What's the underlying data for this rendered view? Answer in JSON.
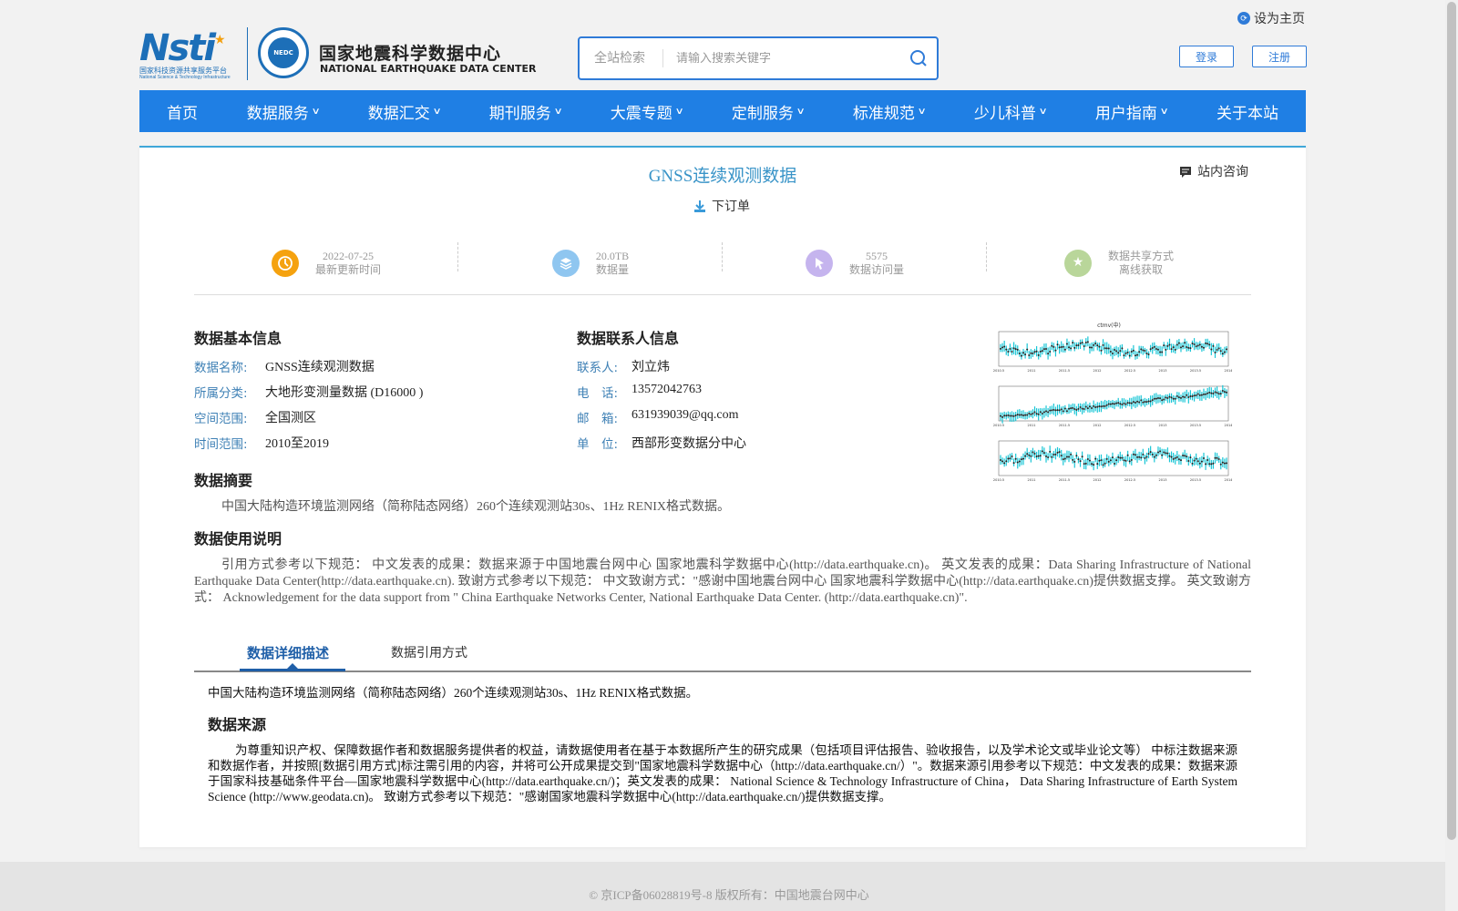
{
  "header": {
    "set_home": "设为主页",
    "logo": {
      "nsti_text": "Nsti",
      "nsti_sub": "国家科技资源共享服务平台",
      "nsti_sub_en": "National Science & Technology Infrastructure",
      "seal_text": "NEDC",
      "cn_name": "国家地震科学数据中心",
      "en_name": "NATIONAL EARTHQUAKE DATA CENTER"
    },
    "search": {
      "scope": "全站检索",
      "placeholder": "请输入搜索关键字"
    },
    "login": "登录",
    "register": "注册"
  },
  "nav": [
    {
      "label": "首页",
      "has_dropdown": false
    },
    {
      "label": "数据服务",
      "has_dropdown": true
    },
    {
      "label": "数据汇交",
      "has_dropdown": true
    },
    {
      "label": "期刊服务",
      "has_dropdown": true
    },
    {
      "label": "大震专题",
      "has_dropdown": true
    },
    {
      "label": "定制服务",
      "has_dropdown": true
    },
    {
      "label": "标准规范",
      "has_dropdown": true
    },
    {
      "label": "少儿科普",
      "has_dropdown": true
    },
    {
      "label": "用户指南",
      "has_dropdown": true
    },
    {
      "label": "关于本站",
      "has_dropdown": false
    }
  ],
  "dataset": {
    "title": "GNSS连续观测数据",
    "order": "下订单",
    "consult": "站内咨询",
    "stats": [
      {
        "value": "2022-07-25",
        "label": "最新更新时间",
        "icon": "clock-icon",
        "color": "#f5a20f"
      },
      {
        "value": "20.0TB",
        "label": "数据量",
        "icon": "layers-icon",
        "color": "#8fc6f0"
      },
      {
        "value": "5575",
        "label": "数据访问量",
        "icon": "cursor-icon",
        "color": "#c5b4ee"
      },
      {
        "value": "数据共享方式",
        "label": "离线获取",
        "icon": "star-icon",
        "color": "#b9d69a"
      }
    ],
    "basic_info": {
      "heading": "数据基本信息",
      "fields": [
        {
          "key": "数据名称:",
          "value": "GNSS连续观测数据"
        },
        {
          "key": "所属分类:",
          "value": "大地形变测量数据 (D16000 )"
        },
        {
          "key": "空间范围:",
          "value": "全国测区"
        },
        {
          "key": "时间范围:",
          "value": "2010至2019"
        }
      ]
    },
    "contact_info": {
      "heading": "数据联系人信息",
      "fields": [
        {
          "key": "联系人:",
          "value": "刘立炜"
        },
        {
          "key": "电　话:",
          "value": "13572042763"
        },
        {
          "key": "邮　箱:",
          "value": "631939039@qq.com"
        },
        {
          "key": "单　位:",
          "value": "西部形变数据分中心"
        }
      ]
    },
    "abstract": {
      "heading": "数据摘要",
      "text": "中国大陆构造环境监测网络（简称陆态网络）260个连续观测站30s、1Hz RENIX格式数据。"
    },
    "usage": {
      "heading": "数据使用说明",
      "text": "引用方式参考以下规范： 中文发表的成果：数据来源于中国地震台网中心 国家地震科学数据中心(http://data.earthquake.cn)。 英文发表的成果：Data Sharing Infrastructure of National Earthquake Data Center(http://data.earthquake.cn). 致谢方式参考以下规范： 中文致谢方式：\"感谢中国地震台网中心 国家地震科学数据中心(http://data.earthquake.cn)提供数据支撑。 英文致谢方式： Acknowledgement for the data support from \" China Earthquake Networks Center, National Earthquake Data Center. (http://data.earthquake.cn)\"."
    },
    "plot": {
      "title": "ctmv(中)",
      "axis_labels": [
        "2010.5",
        "2011",
        "2011.5",
        "2012",
        "2012.5",
        "2013",
        "2013.5",
        "2014"
      ]
    },
    "tabs": [
      {
        "label": "数据详细描述",
        "active": true
      },
      {
        "label": "数据引用方式",
        "active": false
      }
    ],
    "detail": {
      "intro": "中国大陆构造环境监测网络（简称陆态网络）260个连续观测站30s、1Hz RENIX格式数据。",
      "source_heading": "数据来源",
      "source_text": "为尊重知识产权、保障数据作者和数据服务提供者的权益，请数据使用者在基于本数据所产生的研究成果（包括项目评估报告、验收报告，以及学术论文或毕业论文等） 中标注数据来源和数据作者，并按照[数据引用方式]标注需引用的内容，并将可公开成果提交到\"国家地震科学数据中心（http://data.earthquake.cn/）\"。数据来源引用参考以下规范：中文发表的成果：数据来源于国家科技基础条件平台—国家地震科学数据中心(http://data.earthquake.cn/)；英文发表的成果： National Science & Technology Infrastructure of China， Data Sharing Infrastructure of Earth System Science (http://www.geodata.cn)。 致谢方式参考以下规范：\"感谢国家地震科学数据中心(http://data.earthquake.cn/)提供数据支撑。"
    }
  },
  "footer": {
    "text": "© 京ICP备06028819号-8 版权所有：中国地震台网中心"
  }
}
